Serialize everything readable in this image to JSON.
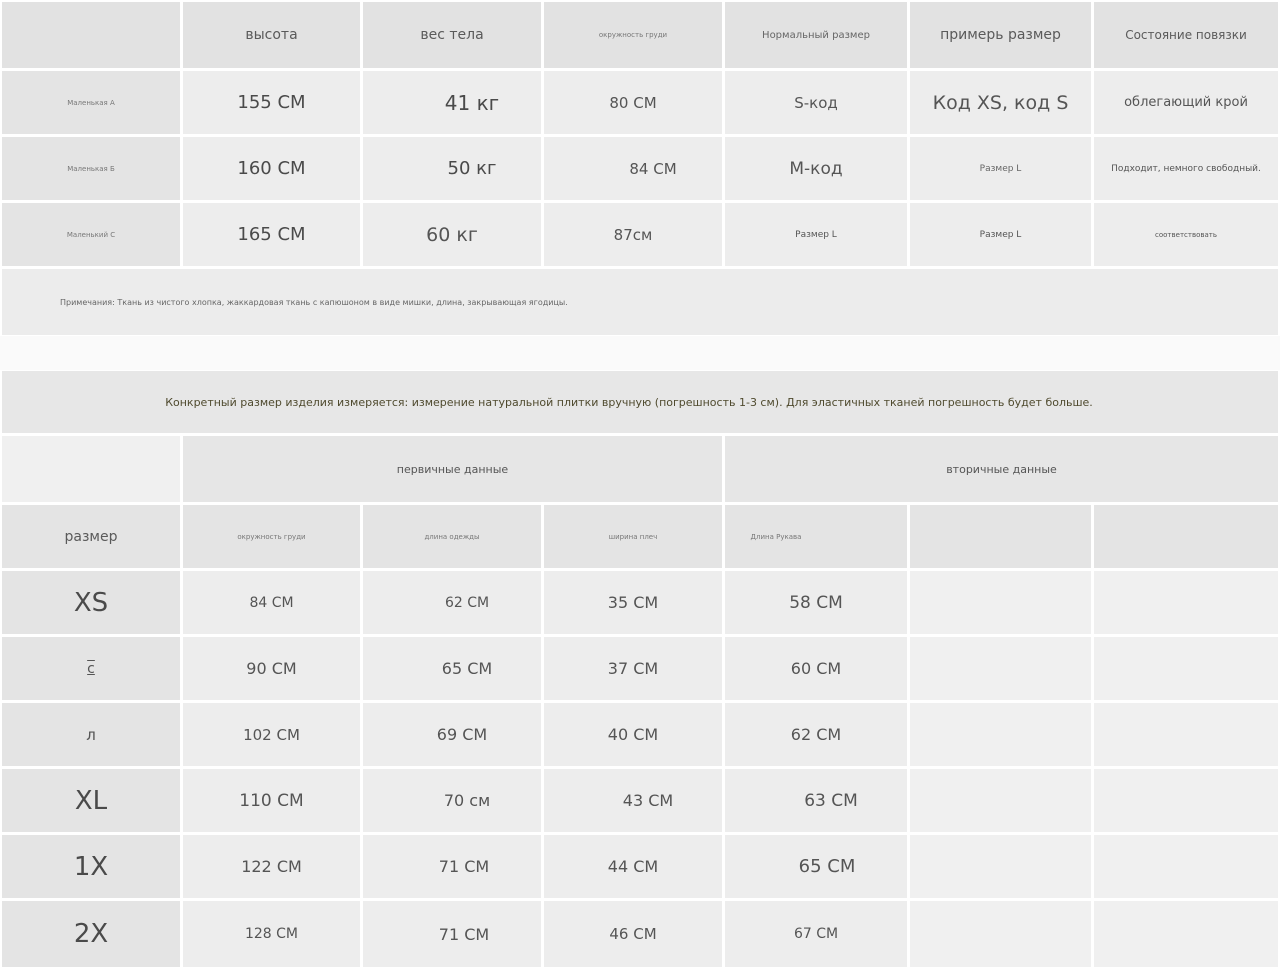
{
  "table1": {
    "headers": [
      "высота",
      "вес тела",
      "окружность груди",
      "Нормальный размер",
      "примерь размер",
      "Состояние повязки"
    ],
    "rows": [
      {
        "label": "Маленькая А",
        "cells": [
          "155 СМ",
          "41 кг",
          "80 СМ",
          "S-код",
          "Код XS, код S",
          "облегающий крой"
        ]
      },
      {
        "label": "Маленькая Б",
        "cells": [
          "160 СМ",
          "50 кг",
          "84 СМ",
          "М-код",
          "Размер L",
          "Подходит, немного свободный."
        ]
      },
      {
        "label": "Маленький С",
        "cells": [
          "165 СМ",
          "60 кг",
          "87см",
          "Размер L",
          "Размер L",
          "соответствовать"
        ]
      }
    ],
    "note": "Примечания: Ткань из чистого хлопка, жаккардовая ткань с капюшоном в виде мишки, длина, закрывающая ягодицы."
  },
  "notice": "Конкретный размер изделия измеряется: измерение натуральной плитки вручную (погрешность 1-3 см). Для эластичных тканей погрешность будет больше.",
  "table2": {
    "group_primary": "первичные данные",
    "group_secondary": "вторичные данные",
    "size_header": "размер",
    "subheaders": [
      "окружность груди",
      "длина одежды",
      "ширина плеч",
      "Длина Рукава",
      "",
      ""
    ],
    "rows": [
      {
        "size": "XS",
        "cells": [
          "84 СМ",
          "62 СМ",
          "35 СМ",
          "58 СМ",
          "",
          ""
        ]
      },
      {
        "size": "с",
        "cells": [
          "90 СМ",
          "65 СМ",
          "37 СМ",
          "60 СМ",
          "",
          ""
        ]
      },
      {
        "size": "л",
        "cells": [
          "102 СМ",
          "69 СМ",
          "40 СМ",
          "62 СМ",
          "",
          ""
        ]
      },
      {
        "size": "XL",
        "cells": [
          "110 СМ",
          "70 см",
          "43 СМ",
          "63 СМ",
          "",
          ""
        ]
      },
      {
        "size": "1X",
        "cells": [
          "122 СМ",
          "71 СМ",
          "44 СМ",
          "65 СМ",
          "",
          ""
        ]
      },
      {
        "size": "2X",
        "cells": [
          "128 СМ",
          "71 СМ",
          "46 СМ",
          "67 СМ",
          "",
          ""
        ]
      }
    ]
  }
}
